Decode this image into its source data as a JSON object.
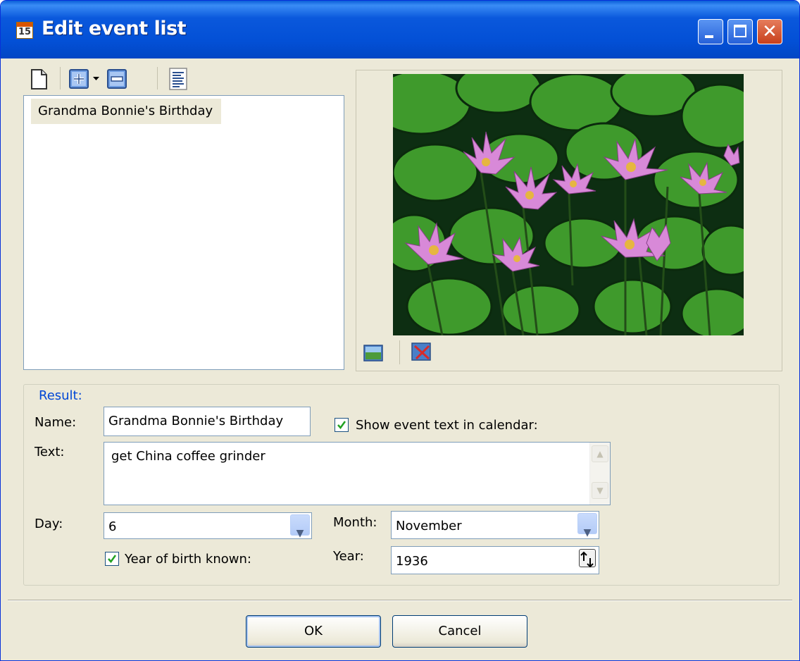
{
  "window": {
    "title": "Edit event list",
    "icon_day": "15",
    "buttons": [
      "minimize-icon",
      "maximize-icon",
      "close-icon"
    ]
  },
  "toolbar": {
    "icons": [
      "new-document-icon",
      "add-icon",
      "dropdown-arrow-icon",
      "remove-icon",
      "list-properties-icon"
    ]
  },
  "event_list": {
    "items": [
      "Grandma Bonnie's Birthday"
    ],
    "selected_index": 0
  },
  "image_panel": {
    "image_icons": [
      "insert-image-icon",
      "delete-image-icon"
    ]
  },
  "result": {
    "legend": "Result:",
    "name_label": "Name:",
    "name_value": "Grandma Bonnie's Birthday",
    "show_event_text_label": "Show event text in calendar:",
    "show_event_text_checked": true,
    "text_label": "Text:",
    "text_value": "get China coffee grinder",
    "day_label": "Day:",
    "day_value": "6",
    "month_label": "Month:",
    "month_value": "November",
    "year_known_label": "Year of birth known:",
    "year_known_checked": true,
    "year_label": "Year:",
    "year_value": "1936"
  },
  "buttons": {
    "ok": "OK",
    "cancel": "Cancel"
  },
  "colors": {
    "title_bar": "#0350d6",
    "dialog_background": "#ece9d8",
    "group_legend": "#0046d5",
    "close_button": "#c8401c"
  }
}
